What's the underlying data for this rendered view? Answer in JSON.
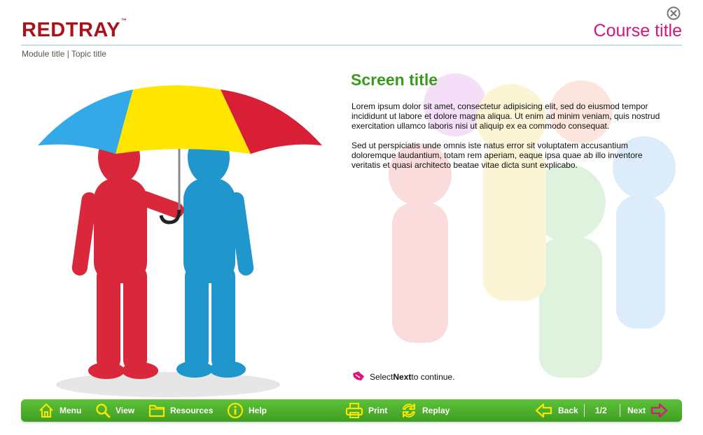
{
  "header": {
    "logo_text": "REDTRAY",
    "logo_tm": "™",
    "course_title": "Course title",
    "breadcrumb": "Module title | Topic title",
    "close_icon": "close-circle-icon"
  },
  "content": {
    "screen_title": "Screen title",
    "paragraphs": [
      "Lorem ipsum dolor sit amet, consectetur adipisicing elit, sed do eiusmod tempor incididunt ut labore et dolore magna aliqua. Ut enim ad minim veniam, quis nostrud exercitation ullamco laboris nisi ut aliquip ex ea commodo consequat.",
      "Sed ut perspiciatis unde omnis iste natus error sit voluptatem accusantium doloremque laudantium, totam rem aperiam, eaque ipsa quae ab illo inventore veritatis et quasi architecto beatae vitae dicta sunt explicabo."
    ],
    "instruction": {
      "prefix": "Select ",
      "bold": "Next",
      "suffix": " to continue."
    }
  },
  "footer": {
    "menu_label": "Menu",
    "view_label": "View",
    "resources_label": "Resources",
    "help_label": "Help",
    "print_label": "Print",
    "replay_label": "Replay",
    "back_label": "Back",
    "page_indicator": "1/2",
    "next_label": "Next"
  },
  "colors": {
    "brand_red": "#a8141b",
    "course_title": "#d4157a",
    "screen_title": "#3a9a1e",
    "footer_green": "#4cb12d",
    "icon_yellow": "#f7e600",
    "next_arrow": "#e4127b"
  }
}
